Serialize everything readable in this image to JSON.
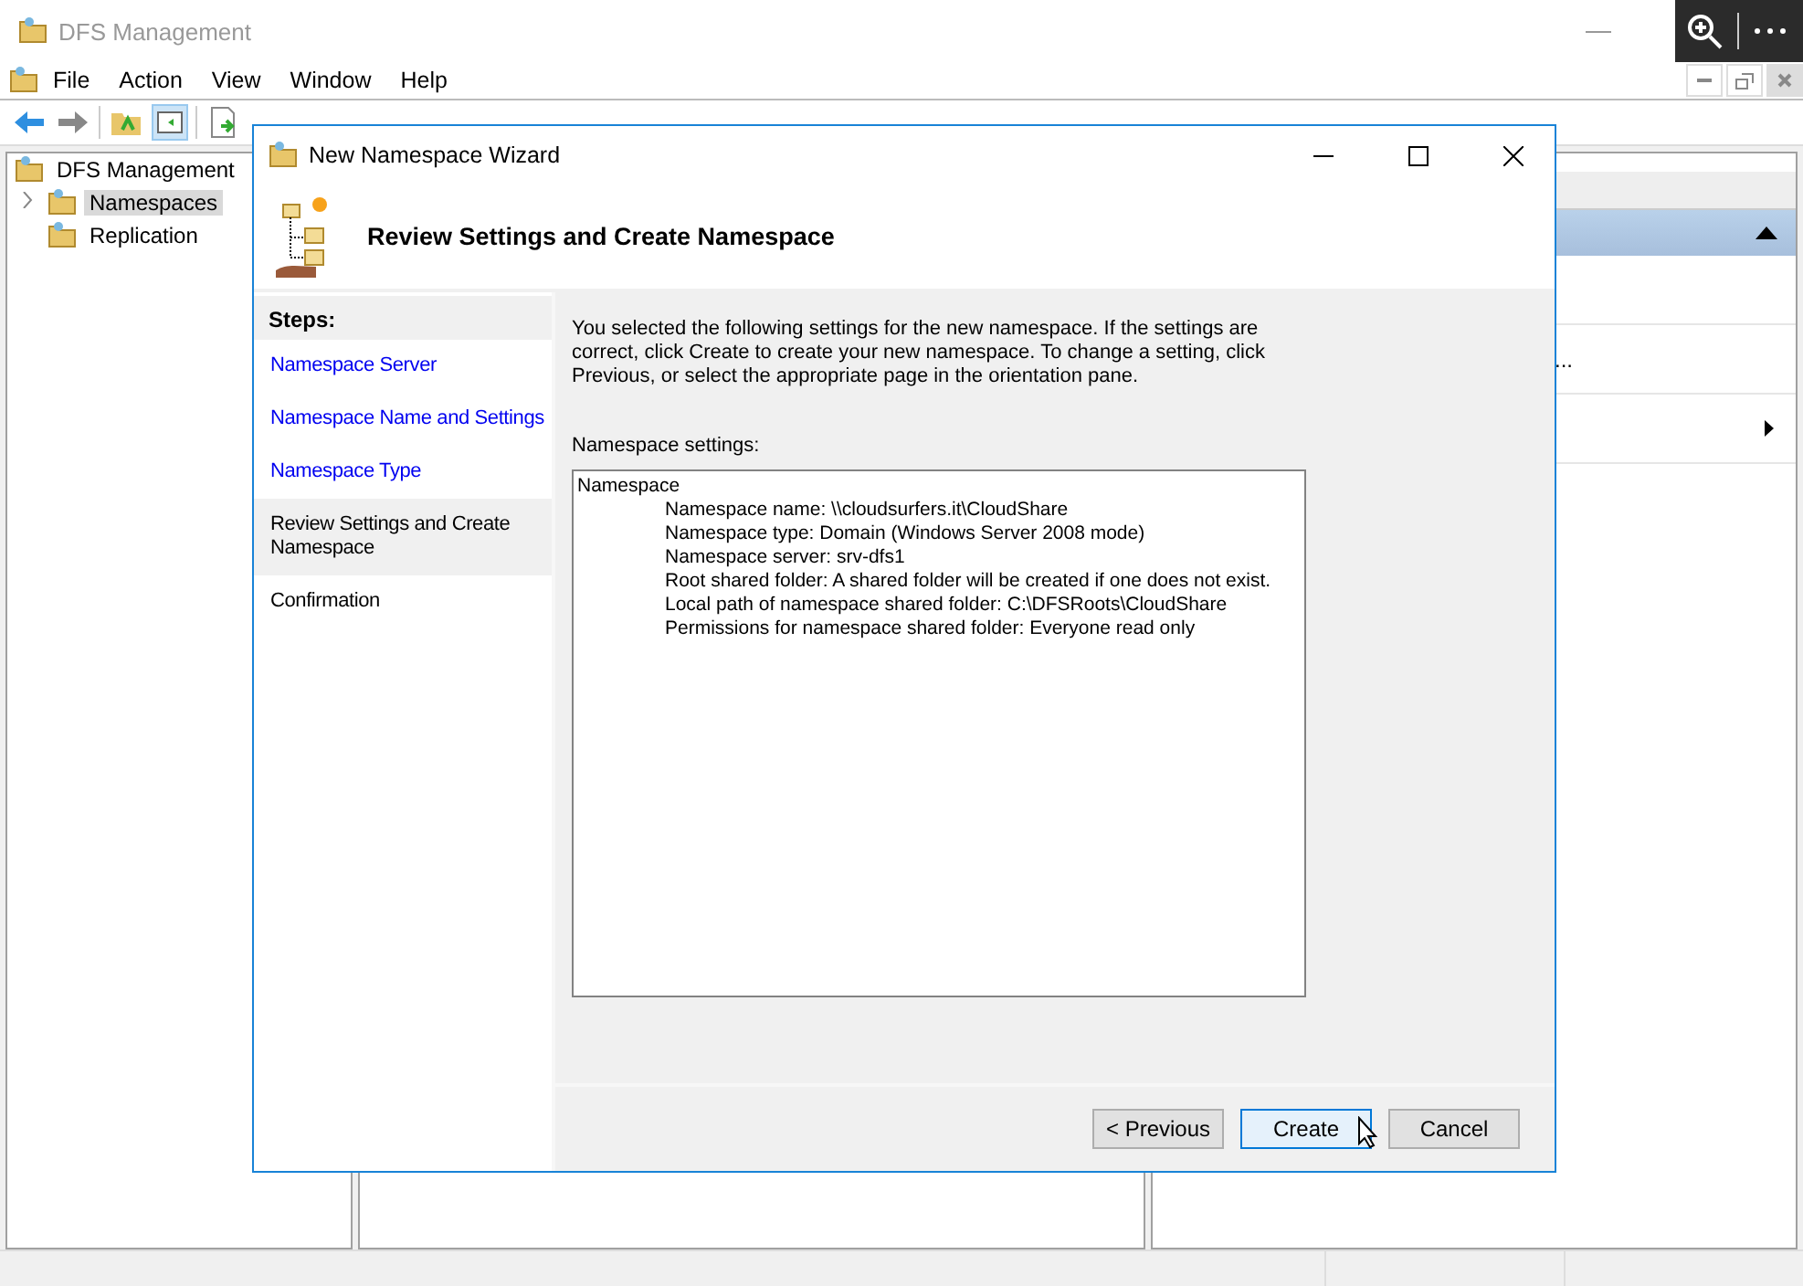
{
  "window": {
    "title": "DFS Management"
  },
  "menu": [
    "File",
    "Action",
    "View",
    "Window",
    "Help"
  ],
  "tree": [
    {
      "label": "DFS Management",
      "selected": false,
      "children": [
        {
          "label": "Namespaces",
          "selected": true,
          "expanded": false
        },
        {
          "label": "Replication",
          "selected": false
        }
      ]
    }
  ],
  "actions_pane": {
    "items": [
      {
        "label": "...",
        "submenu": false
      },
      {
        "submenu": true
      }
    ]
  },
  "wizard": {
    "title": "New Namespace Wizard",
    "heading": "Review Settings and Create Namespace",
    "steps_title": "Steps:",
    "steps": [
      {
        "label": "Namespace Server",
        "kind": "link",
        "selected": false
      },
      {
        "label": "Namespace Name and Settings",
        "kind": "link",
        "selected": false
      },
      {
        "label": "Namespace Type",
        "kind": "link",
        "selected": false
      },
      {
        "label": "Review Settings and Create Namespace",
        "kind": "text",
        "selected": true
      },
      {
        "label": "Confirmation",
        "kind": "text",
        "selected": false
      }
    ],
    "intro": "You selected the following settings for the new namespace. If the settings are correct, click Create to create your new namespace. To change a setting, click Previous, or select the appropriate page in the orientation pane.",
    "settings_label": "Namespace settings:",
    "settings": {
      "heading": "Namespace",
      "lines": [
        "Namespace name: \\\\cloudsurfers.it\\CloudShare",
        "Namespace type:  Domain (Windows Server 2008 mode)",
        "Namespace server: srv-dfs1",
        "Root shared folder:  A shared folder will be created if one does not exist.",
        "Local path of namespace shared folder: C:\\DFSRoots\\CloudShare",
        "Permissions for namespace shared folder: Everyone read only"
      ]
    },
    "buttons": [
      {
        "label": "< Previous",
        "focused": false
      },
      {
        "label": "Create",
        "focused": true
      },
      {
        "label": "Cancel",
        "focused": false
      }
    ]
  }
}
